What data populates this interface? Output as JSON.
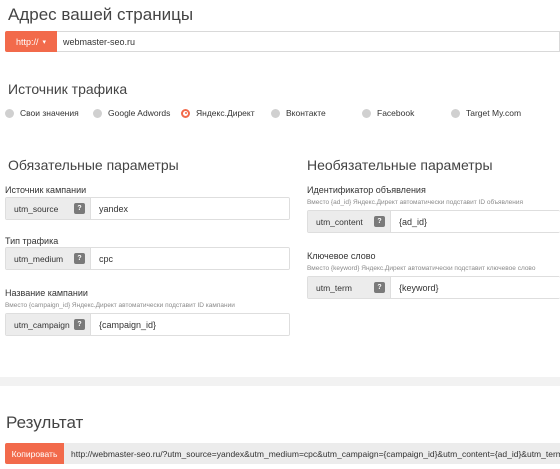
{
  "page": {
    "title": "Адрес вашей страницы",
    "protocol": "http://",
    "url": "webmaster-seo.ru"
  },
  "traffic": {
    "title": "Источник трафика",
    "options": [
      "Свои значения",
      "Google Adwords",
      "Яндекс.Директ",
      "Вконтакте",
      "Facebook",
      "Target My.com"
    ],
    "selected": "Яндекс.Директ"
  },
  "required": {
    "title": "Обязательные параметры",
    "fields": [
      {
        "label": "Источник кампании",
        "key": "utm_source",
        "value": "yandex",
        "hint": ""
      },
      {
        "label": "Тип трафика",
        "key": "utm_medium",
        "value": "cpc",
        "hint": ""
      },
      {
        "label": "Название кампании",
        "key": "utm_campaign",
        "value": "{campaign_id}",
        "hint": "Вместо {campaign_id} Яндекс.Директ автоматически подставит ID кампании"
      }
    ]
  },
  "optional": {
    "title": "Необязательные параметры",
    "fields": [
      {
        "label": "Идентификатор объявления",
        "key": "utm_content",
        "value": "{ad_id}",
        "hint": "Вместо {ad_id} Яндекс.Директ автоматически подставит ID объявления"
      },
      {
        "label": "Ключевое слово",
        "key": "utm_term",
        "value": "{keyword}",
        "hint": "Вместо {keyword} Яндекс.Директ автоматически подставит ключевое слово"
      }
    ]
  },
  "result": {
    "title": "Результат",
    "copy_label": "Копировать",
    "url": "http://webmaster-seo.ru/?utm_source=yandex&utm_medium=cpc&utm_campaign={campaign_id}&utm_content={ad_id}&utm_term={keyword}"
  },
  "help_symbol": "?",
  "caret_symbol": "▾",
  "colors": {
    "accent": "#f26a4b",
    "key_bg": "#ececec",
    "band": "#f2f2f2"
  }
}
